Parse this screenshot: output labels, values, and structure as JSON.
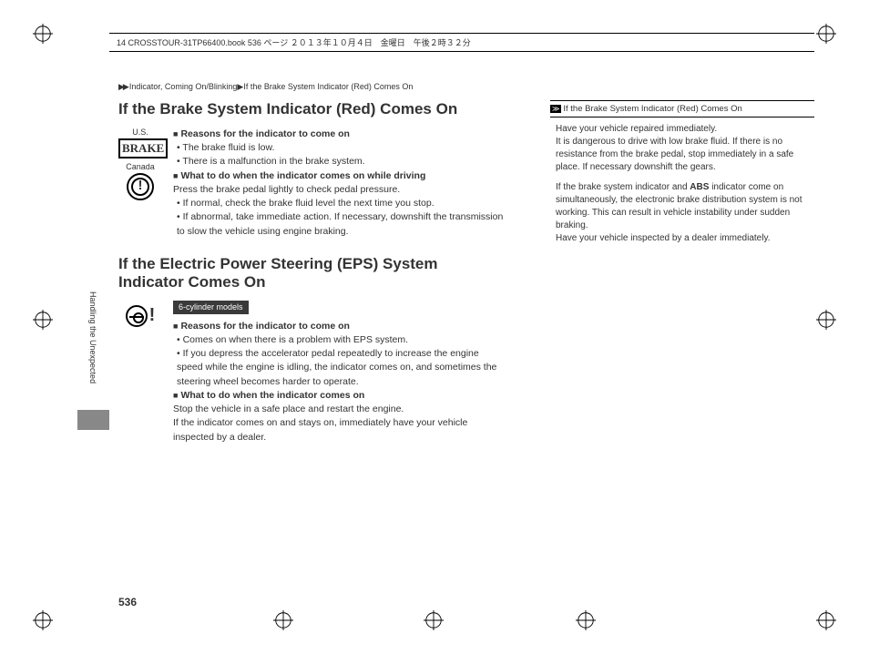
{
  "header": {
    "line": "14 CROSSTOUR-31TP66400.book  536 ページ  ２０１３年１０月４日　金曜日　午後２時３２分"
  },
  "crumb": {
    "section": "Indicator, Coming On/Blinking",
    "sub": "If the Brake System Indicator (Red) Comes On"
  },
  "s1": {
    "title": "If the Brake System Indicator (Red) Comes On",
    "us_label": "U.S.",
    "brake_text": "BRAKE",
    "canada_label": "Canada",
    "h1": "Reasons for the indicator to come on",
    "b1": "The brake fluid is low.",
    "b2": "There is a malfunction in the brake system.",
    "h2": "What to do when the indicator comes on while driving",
    "p1": "Press the brake pedal lightly to check pedal pressure.",
    "b3": "If normal, check the brake fluid level the next time you stop.",
    "b4": "If abnormal, take immediate action. If necessary, downshift the transmission to slow the vehicle using engine braking."
  },
  "s2": {
    "title": "If the Electric Power Steering (EPS) System Indicator Comes On",
    "badge": "6-cylinder models",
    "h1": "Reasons for the indicator to come on",
    "b1": "Comes on when there is a problem with EPS system.",
    "b2": "If you depress the accelerator pedal repeatedly to increase the engine speed while the engine is idling, the indicator comes on, and sometimes the steering wheel becomes harder to operate.",
    "h2": "What to do when the indicator comes on",
    "p1": "Stop the vehicle in a safe place and restart the engine.",
    "p2": "If the indicator comes on and stays on, immediately have your vehicle inspected by a dealer."
  },
  "side": {
    "title": "If the Brake System Indicator (Red) Comes On",
    "p1": "Have your vehicle repaired immediately.",
    "p2": "It is dangerous to drive with low brake fluid. If there is no resistance from the brake pedal, stop immediately in a safe place. If necessary downshift the gears.",
    "p3a": "If the brake system indicator and ",
    "abs": "ABS",
    "p3b": " indicator come on simultaneously, the electronic brake distribution system is not working. This can result in vehicle instability under sudden braking.",
    "p4": "Have your vehicle inspected by a dealer immediately."
  },
  "tab": "Handling the Unexpected",
  "page_num": "536"
}
